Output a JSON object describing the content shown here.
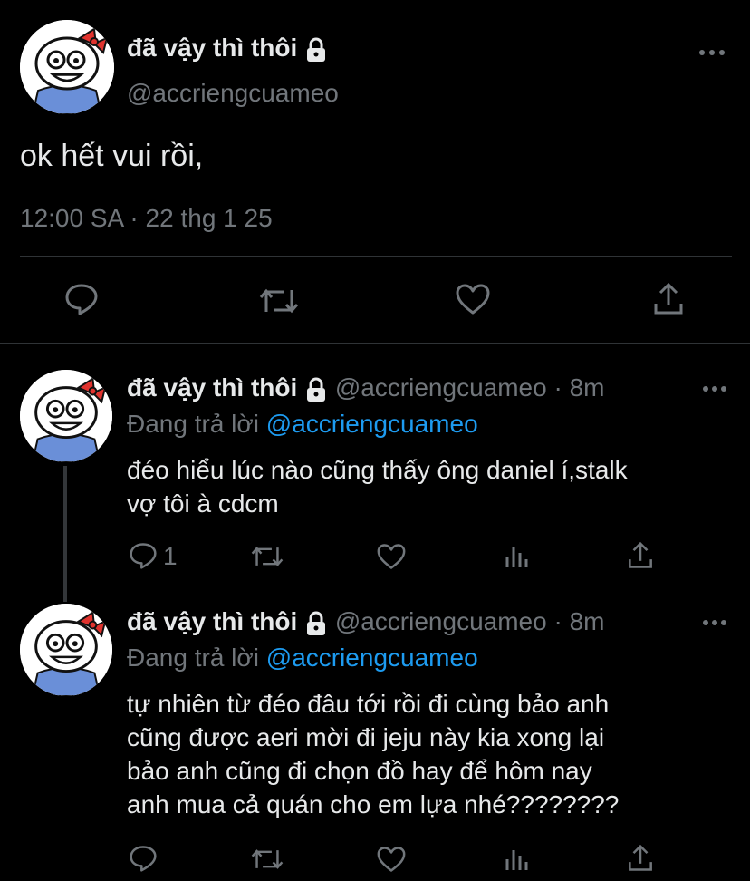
{
  "main_tweet": {
    "display_name": "đã vậy thì thôi",
    "handle": "@accriengcuameo",
    "text": "ok hết vui rồi,",
    "timestamp": "12:00 SA · 22 thg 1 25"
  },
  "replies": [
    {
      "display_name": "đã vậy thì thôi",
      "handle": "@accriengcuameo",
      "time": "· 8m",
      "replying_prefix": "Đang trả lời",
      "replying_to": "@accriengcuameo",
      "text_lines": [
        "đéo hiểu lúc nào cũng thấy ông daniel í,stalk",
        "vợ tôi à cdcm"
      ],
      "reply_count": "1"
    },
    {
      "display_name": "đã vậy thì thôi",
      "handle": "@accriengcuameo",
      "time": "· 8m",
      "replying_prefix": "Đang trả lời",
      "replying_to": "@accriengcuameo",
      "text_lines": [
        "tự nhiên từ đéo đâu tới rồi đi cùng bảo anh",
        "cũng được aeri mời đi jeju này kia xong lại",
        "bảo anh cũng đi chọn đồ hay để hôm nay",
        "anh mua cả quán cho em lựa nhé????????"
      ],
      "reply_count": ""
    }
  ],
  "colors": {
    "background": "#000000",
    "text": "#e7e9ea",
    "muted": "#71767b",
    "link": "#1d9bf0",
    "divider": "#2f3336"
  },
  "icons": [
    "more-icon",
    "lock-icon",
    "reply-icon",
    "retweet-icon",
    "like-icon",
    "views-icon",
    "share-icon"
  ]
}
